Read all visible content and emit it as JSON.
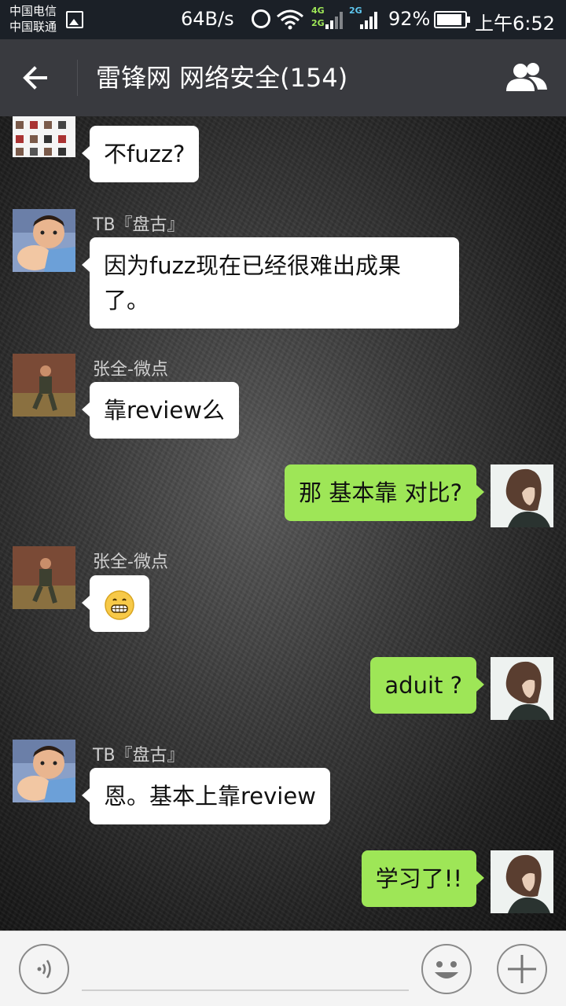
{
  "status_bar": {
    "carrier_1": "中国电信",
    "carrier_2": "中国联通",
    "net_speed": "64B/s",
    "sim1_badge_top": "4G",
    "sim1_badge_bottom": "2G",
    "sim2_badge": "2G",
    "battery": "92%",
    "battery_level": 0.92,
    "time": "上午6:52",
    "icons": [
      "gallery-icon",
      "alarm-icon",
      "wifi-icon",
      "signal-icon",
      "battery-icon"
    ]
  },
  "header": {
    "title": "雷锋网 网络安全(154)",
    "back_icon": "back-arrow-icon",
    "members_icon": "group-members-icon"
  },
  "messages": [
    {
      "side": "in",
      "sender": "",
      "avatar": "avatar-grid",
      "text": "不fuzz?"
    },
    {
      "side": "in",
      "sender": "TB『盘古』",
      "avatar": "avatar-child",
      "text": "因为fuzz现在已经很难出成果了。"
    },
    {
      "side": "in",
      "sender": "张全-微点",
      "avatar": "avatar-runner",
      "text": "靠review么"
    },
    {
      "side": "out",
      "sender": "",
      "avatar": "avatar-girl",
      "text": "那 基本靠 对比?"
    },
    {
      "side": "in",
      "sender": "张全-微点",
      "avatar": "avatar-runner",
      "text": "",
      "emoji": "grin-emoji"
    },
    {
      "side": "out",
      "sender": "",
      "avatar": "avatar-girl",
      "text": "aduit ?"
    },
    {
      "side": "in",
      "sender": "TB『盘古』",
      "avatar": "avatar-child",
      "text": "恩。基本上靠review"
    },
    {
      "side": "out",
      "sender": "",
      "avatar": "avatar-girl",
      "text": "学习了!!"
    }
  ],
  "input_bar": {
    "voice_icon": "voice-icon",
    "emoji_icon": "emoji-icon",
    "plus_icon": "plus-icon",
    "placeholder": ""
  }
}
